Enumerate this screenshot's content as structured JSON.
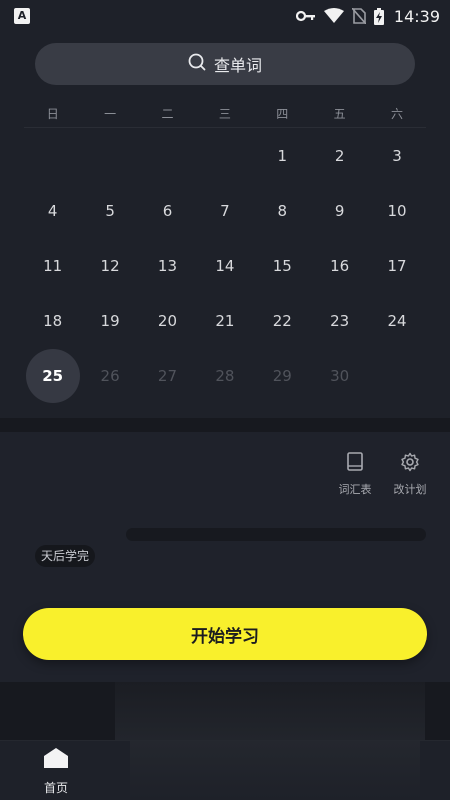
{
  "status_bar": {
    "time": "14:39",
    "app_badge": "A",
    "icons": [
      "key-icon",
      "wifi-icon",
      "no-sim-icon",
      "battery-charging-icon"
    ]
  },
  "search": {
    "label": "查单词",
    "icon": "search-icon"
  },
  "calendar": {
    "weekdays": [
      "日",
      "一",
      "二",
      "三",
      "四",
      "五",
      "六"
    ],
    "weeks": [
      [
        "",
        "",
        "",
        "",
        "1",
        "2",
        "3"
      ],
      [
        "4",
        "5",
        "6",
        "7",
        "8",
        "9",
        "10"
      ],
      [
        "11",
        "12",
        "13",
        "14",
        "15",
        "16",
        "17"
      ],
      [
        "18",
        "19",
        "20",
        "21",
        "22",
        "23",
        "24"
      ],
      [
        "25",
        "26",
        "27",
        "28",
        "29",
        "30",
        ""
      ]
    ],
    "today": "25"
  },
  "panel": {
    "tools": [
      {
        "label": "词汇表",
        "icon": "book-icon"
      },
      {
        "label": "改计划",
        "icon": "gear-icon"
      }
    ],
    "chip": "天后学完",
    "start_button": "开始学习"
  },
  "bottom_nav": {
    "home_label": "首页",
    "home_icon": "home-icon"
  },
  "colors": {
    "accent": "#f9f02c",
    "background": "#1e2129"
  }
}
